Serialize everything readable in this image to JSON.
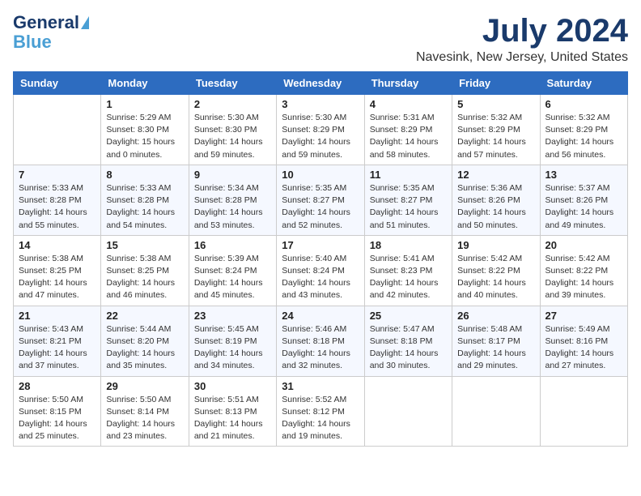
{
  "header": {
    "logo_line1": "General",
    "logo_line2": "Blue",
    "month_title": "July 2024",
    "location": "Navesink, New Jersey, United States"
  },
  "days_of_week": [
    "Sunday",
    "Monday",
    "Tuesday",
    "Wednesday",
    "Thursday",
    "Friday",
    "Saturday"
  ],
  "weeks": [
    [
      {
        "day": "",
        "info": ""
      },
      {
        "day": "1",
        "info": "Sunrise: 5:29 AM\nSunset: 8:30 PM\nDaylight: 15 hours\nand 0 minutes."
      },
      {
        "day": "2",
        "info": "Sunrise: 5:30 AM\nSunset: 8:30 PM\nDaylight: 14 hours\nand 59 minutes."
      },
      {
        "day": "3",
        "info": "Sunrise: 5:30 AM\nSunset: 8:29 PM\nDaylight: 14 hours\nand 59 minutes."
      },
      {
        "day": "4",
        "info": "Sunrise: 5:31 AM\nSunset: 8:29 PM\nDaylight: 14 hours\nand 58 minutes."
      },
      {
        "day": "5",
        "info": "Sunrise: 5:32 AM\nSunset: 8:29 PM\nDaylight: 14 hours\nand 57 minutes."
      },
      {
        "day": "6",
        "info": "Sunrise: 5:32 AM\nSunset: 8:29 PM\nDaylight: 14 hours\nand 56 minutes."
      }
    ],
    [
      {
        "day": "7",
        "info": "Sunrise: 5:33 AM\nSunset: 8:28 PM\nDaylight: 14 hours\nand 55 minutes."
      },
      {
        "day": "8",
        "info": "Sunrise: 5:33 AM\nSunset: 8:28 PM\nDaylight: 14 hours\nand 54 minutes."
      },
      {
        "day": "9",
        "info": "Sunrise: 5:34 AM\nSunset: 8:28 PM\nDaylight: 14 hours\nand 53 minutes."
      },
      {
        "day": "10",
        "info": "Sunrise: 5:35 AM\nSunset: 8:27 PM\nDaylight: 14 hours\nand 52 minutes."
      },
      {
        "day": "11",
        "info": "Sunrise: 5:35 AM\nSunset: 8:27 PM\nDaylight: 14 hours\nand 51 minutes."
      },
      {
        "day": "12",
        "info": "Sunrise: 5:36 AM\nSunset: 8:26 PM\nDaylight: 14 hours\nand 50 minutes."
      },
      {
        "day": "13",
        "info": "Sunrise: 5:37 AM\nSunset: 8:26 PM\nDaylight: 14 hours\nand 49 minutes."
      }
    ],
    [
      {
        "day": "14",
        "info": "Sunrise: 5:38 AM\nSunset: 8:25 PM\nDaylight: 14 hours\nand 47 minutes."
      },
      {
        "day": "15",
        "info": "Sunrise: 5:38 AM\nSunset: 8:25 PM\nDaylight: 14 hours\nand 46 minutes."
      },
      {
        "day": "16",
        "info": "Sunrise: 5:39 AM\nSunset: 8:24 PM\nDaylight: 14 hours\nand 45 minutes."
      },
      {
        "day": "17",
        "info": "Sunrise: 5:40 AM\nSunset: 8:24 PM\nDaylight: 14 hours\nand 43 minutes."
      },
      {
        "day": "18",
        "info": "Sunrise: 5:41 AM\nSunset: 8:23 PM\nDaylight: 14 hours\nand 42 minutes."
      },
      {
        "day": "19",
        "info": "Sunrise: 5:42 AM\nSunset: 8:22 PM\nDaylight: 14 hours\nand 40 minutes."
      },
      {
        "day": "20",
        "info": "Sunrise: 5:42 AM\nSunset: 8:22 PM\nDaylight: 14 hours\nand 39 minutes."
      }
    ],
    [
      {
        "day": "21",
        "info": "Sunrise: 5:43 AM\nSunset: 8:21 PM\nDaylight: 14 hours\nand 37 minutes."
      },
      {
        "day": "22",
        "info": "Sunrise: 5:44 AM\nSunset: 8:20 PM\nDaylight: 14 hours\nand 35 minutes."
      },
      {
        "day": "23",
        "info": "Sunrise: 5:45 AM\nSunset: 8:19 PM\nDaylight: 14 hours\nand 34 minutes."
      },
      {
        "day": "24",
        "info": "Sunrise: 5:46 AM\nSunset: 8:18 PM\nDaylight: 14 hours\nand 32 minutes."
      },
      {
        "day": "25",
        "info": "Sunrise: 5:47 AM\nSunset: 8:18 PM\nDaylight: 14 hours\nand 30 minutes."
      },
      {
        "day": "26",
        "info": "Sunrise: 5:48 AM\nSunset: 8:17 PM\nDaylight: 14 hours\nand 29 minutes."
      },
      {
        "day": "27",
        "info": "Sunrise: 5:49 AM\nSunset: 8:16 PM\nDaylight: 14 hours\nand 27 minutes."
      }
    ],
    [
      {
        "day": "28",
        "info": "Sunrise: 5:50 AM\nSunset: 8:15 PM\nDaylight: 14 hours\nand 25 minutes."
      },
      {
        "day": "29",
        "info": "Sunrise: 5:50 AM\nSunset: 8:14 PM\nDaylight: 14 hours\nand 23 minutes."
      },
      {
        "day": "30",
        "info": "Sunrise: 5:51 AM\nSunset: 8:13 PM\nDaylight: 14 hours\nand 21 minutes."
      },
      {
        "day": "31",
        "info": "Sunrise: 5:52 AM\nSunset: 8:12 PM\nDaylight: 14 hours\nand 19 minutes."
      },
      {
        "day": "",
        "info": ""
      },
      {
        "day": "",
        "info": ""
      },
      {
        "day": "",
        "info": ""
      }
    ]
  ]
}
